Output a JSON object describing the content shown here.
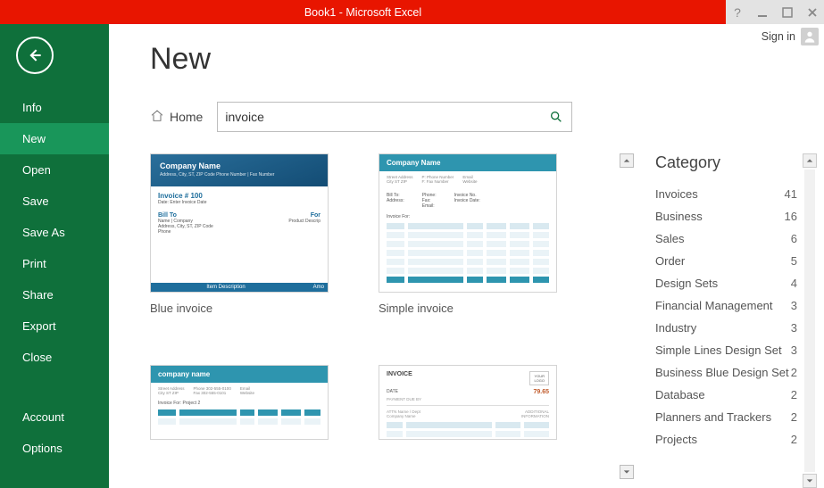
{
  "titlebar": {
    "title": "Book1 -  Microsoft Excel"
  },
  "account": {
    "signin_label": "Sign in"
  },
  "sidebar": {
    "items": [
      {
        "label": "Info"
      },
      {
        "label": "New"
      },
      {
        "label": "Open"
      },
      {
        "label": "Save"
      },
      {
        "label": "Save As"
      },
      {
        "label": "Print"
      },
      {
        "label": "Share"
      },
      {
        "label": "Export"
      },
      {
        "label": "Close"
      }
    ],
    "footer": [
      {
        "label": "Account"
      },
      {
        "label": "Options"
      }
    ],
    "active_index": 1
  },
  "page": {
    "title": "New",
    "home_label": "Home",
    "search_value": "invoice"
  },
  "templates": [
    {
      "label": "Blue invoice"
    },
    {
      "label": "Simple invoice"
    }
  ],
  "thumb_text": {
    "company": "Company Name",
    "company_lc": "company name",
    "addr": "Address, City, ST, ZIP Code\nPhone Number | Fax Number",
    "invno": "Invoice # 100",
    "invdate": "Date: Enter Invoice Date",
    "billto": "Bill To",
    "for": "For",
    "billname": "Name | Company\nAddress, City, ST, ZIP Code\nPhone",
    "proddesc": "Product Descrip",
    "itemdesc": "Item Description",
    "amt": "Amo",
    "invoice_caps": "INVOICE",
    "num": "79.65"
  },
  "categories": {
    "title": "Category",
    "items": [
      {
        "label": "Invoices",
        "count": 41
      },
      {
        "label": "Business",
        "count": 16
      },
      {
        "label": "Sales",
        "count": 6
      },
      {
        "label": "Order",
        "count": 5
      },
      {
        "label": "Design Sets",
        "count": 4
      },
      {
        "label": "Financial Management",
        "count": 3
      },
      {
        "label": "Industry",
        "count": 3
      },
      {
        "label": "Simple Lines Design Set",
        "count": 3
      },
      {
        "label": "Business Blue Design Set",
        "count": 2
      },
      {
        "label": "Database",
        "count": 2
      },
      {
        "label": "Planners and Trackers",
        "count": 2
      },
      {
        "label": "Projects",
        "count": 2
      }
    ]
  }
}
